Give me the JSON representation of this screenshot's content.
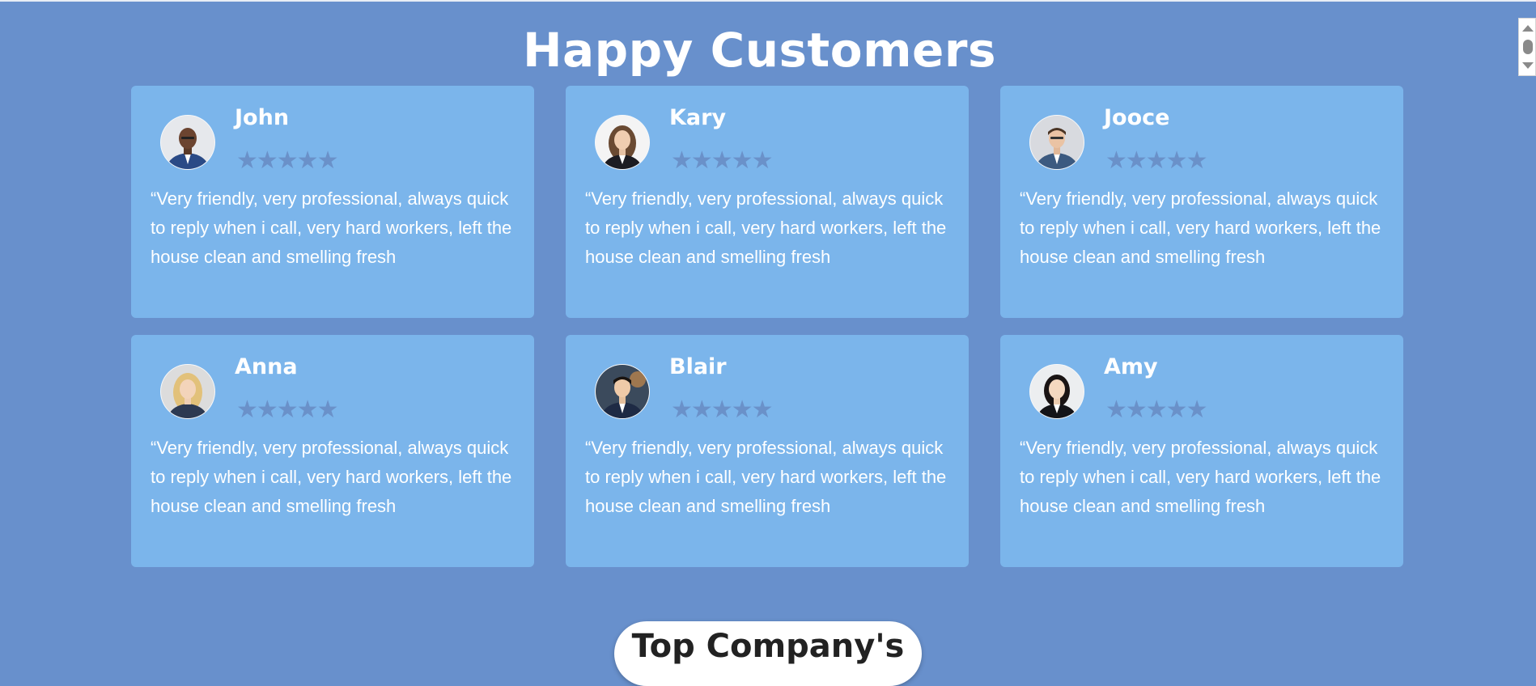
{
  "page": {
    "title": "Happy Customers",
    "next_section": "Top Company's"
  },
  "colors": {
    "background": "#6890cc",
    "card": "#7bb5eb",
    "star": "#6a91c9",
    "text": "#ffffff"
  },
  "rating_glyph": "★★★★★",
  "testimonials": [
    {
      "name": "John",
      "rating": 5,
      "quote": "“Very friendly, very professional, always quick to reply when i call, very hard workers, left the house clean and smelling fresh",
      "avatar": "man-portrait"
    },
    {
      "name": "Kary",
      "rating": 5,
      "quote": "“Very friendly, very professional, always quick to reply when i call, very hard workers, left the house clean and smelling fresh",
      "avatar": "woman-portrait"
    },
    {
      "name": "Jooce",
      "rating": 5,
      "quote": "“Very friendly, very professional, always quick to reply when i call, very hard workers, left the house clean and smelling fresh",
      "avatar": "man-portrait"
    },
    {
      "name": "Anna",
      "rating": 5,
      "quote": "“Very friendly, very professional, always quick to reply when i call, very hard workers, left the house clean and smelling fresh",
      "avatar": "woman-portrait"
    },
    {
      "name": "Blair",
      "rating": 5,
      "quote": "“Very friendly, very professional, always quick to reply when i call, very hard workers, left the house clean and smelling fresh",
      "avatar": "man-portrait"
    },
    {
      "name": "Amy",
      "rating": 5,
      "quote": "“Very friendly, very professional, always quick to reply when i call, very hard workers, left the house clean and smelling fresh",
      "avatar": "woman-portrait"
    }
  ]
}
